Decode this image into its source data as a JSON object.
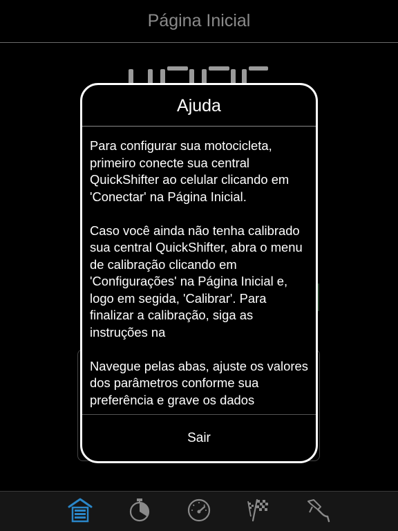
{
  "header": {
    "title": "Página Inicial"
  },
  "dialog": {
    "title": "Ajuda",
    "paragraphs": [
      "Para configurar sua motocicleta, primeiro conecte sua central QuickShifter ao celular clicando em 'Conectar' na Página Inicial.",
      "Caso você ainda não tenha calibrado sua central QuickShifter, abra o menu de calibração clicando em 'Configurações' na Página Inicial e, logo em segida, 'Calibrar'. Para finalizar a calibração, siga as instruções na",
      "Navegue pelas abas, ajuste os valores dos parâmetros conforme sua preferência e grave os dados"
    ],
    "close_label": "Sair"
  },
  "tabbar": {
    "tabs": [
      {
        "icon": "garage-icon",
        "active": true
      },
      {
        "icon": "stopwatch-icon",
        "active": false
      },
      {
        "icon": "speedometer-icon",
        "active": false
      },
      {
        "icon": "checkered-flag-icon",
        "active": false
      },
      {
        "icon": "fuel-nozzle-icon",
        "active": false
      }
    ]
  },
  "colors": {
    "background": "#000000",
    "header_text": "#8a8a8a",
    "dialog_border": "#ffffff",
    "tab_active": "#2a86c8",
    "tab_inactive": "#8a8a8a",
    "tabbar_bg": "#161616"
  }
}
